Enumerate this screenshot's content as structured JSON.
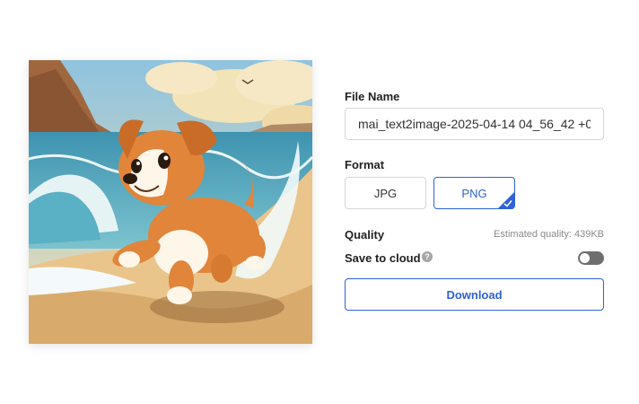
{
  "preview": {
    "icon": "generated-image-dog-on-beach"
  },
  "file_name": {
    "label": "File Name",
    "value": "mai_text2image-2025-04-14 04_56_42 +0"
  },
  "format": {
    "label": "Format",
    "options": [
      "JPG",
      "PNG"
    ],
    "selected": "PNG"
  },
  "quality": {
    "label": "Quality",
    "estimate": "Estimated quality: 439KB"
  },
  "save_to_cloud": {
    "label": "Save to cloud",
    "help_icon": "question-circle-icon",
    "enabled": false
  },
  "download": {
    "label": "Download"
  },
  "colors": {
    "accent": "#2f62d6",
    "toggle_off": "#6e6e6e",
    "muted_text": "#8a8a8a"
  }
}
